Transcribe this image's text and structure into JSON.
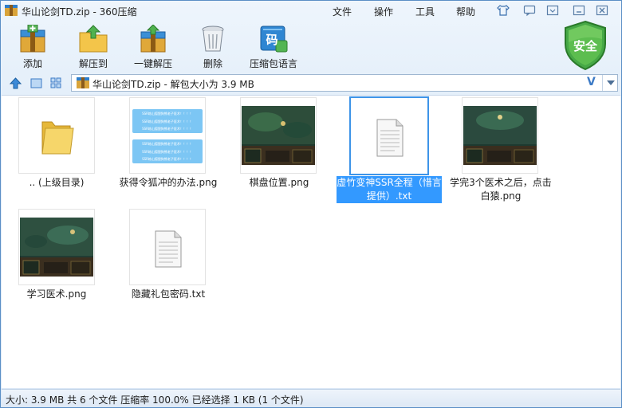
{
  "window": {
    "title": "华山论剑TD.zip - 360压缩"
  },
  "menu": {
    "items": [
      "文件",
      "操作",
      "工具",
      "帮助"
    ]
  },
  "toolbar": {
    "add_label": "添加",
    "extract_to_label": "解压到",
    "one_click_extract_label": "一键解压",
    "delete_label": "删除",
    "zip_lang_label": "压缩包语言",
    "security_badge": "安全",
    "zip_lang_icon_char": "码"
  },
  "address_bar": {
    "path": "华山论剑TD.zip - 解包大小为 3.9 MB",
    "v_label": "V"
  },
  "files": [
    {
      "name": ".. (上级目录)",
      "kind": "folder"
    },
    {
      "name": "获得令狐冲的办法.png",
      "kind": "chat-image"
    },
    {
      "name": "棋盘位置.png",
      "kind": "game-image"
    },
    {
      "name": "虚竹变神SSR全程（惜言提供）.txt",
      "kind": "text",
      "selected": true
    },
    {
      "name": "学完3个医术之后，点击白猿.png",
      "kind": "game-image"
    },
    {
      "name": "学习医术.png",
      "kind": "game-image"
    },
    {
      "name": "隐藏礼包密码.txt",
      "kind": "text"
    }
  ],
  "chat_preview_lines": [
    "SSR练山狐狸狗熊老子医术！！！！",
    "SSR练山狐狸狗熊老子医术！！！！",
    "SSR练山狐狸狗熊老子医术！！！！",
    "SSR练山狐狸狗熊老子医术！！！！",
    "SSR练山狐狸狗熊老子医术！！！！",
    "SSR练山狐狸狗熊老子医术！！！！"
  ],
  "status_bar": {
    "text": "大小: 3.9 MB 共 6 个文件 压缩率 100.0% 已经选择 1 KB (1 个文件)"
  },
  "colors": {
    "selection": "#3399ff",
    "accent_blue": "#3d7bc6",
    "shield_green": "#3a9a3a"
  }
}
